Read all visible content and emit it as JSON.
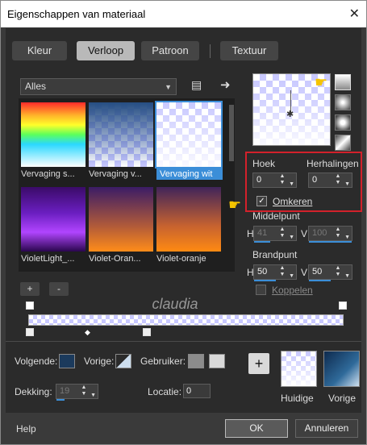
{
  "window": {
    "title": "Eigenschappen van materiaal",
    "close": "✕"
  },
  "tabs": [
    "Kleur",
    "Verloop",
    "Patroon",
    "Textuur"
  ],
  "library": {
    "filter_value": "Alles",
    "thumbnails": [
      {
        "label": "Vervaging s..."
      },
      {
        "label": "Vervaging v..."
      },
      {
        "label": "Vervaging wit"
      },
      {
        "label": "VioletLight_..."
      },
      {
        "label": "Violet-Oran..."
      },
      {
        "label": "Violet-oranje"
      }
    ]
  },
  "settings": {
    "hoek_label": "Hoek",
    "hoek_value": "0",
    "herhalingen_label": "Herhalingen",
    "herhalingen_value": "0",
    "omkeren_label": "Omkeren",
    "omkeren_checked": "✓",
    "middelpunt_label": "Middelpunt",
    "h1_label": "H",
    "h1_value": "41",
    "v1_label": "V",
    "v1_value": "100",
    "brandpunt_label": "Brandpunt",
    "h2_label": "H",
    "h2_value": "50",
    "v2_label": "V",
    "v2_value": "50",
    "koppelen_label": "Koppelen"
  },
  "editor": {
    "add": "+",
    "remove": "-",
    "watermark": "claudia"
  },
  "colors": {
    "volgende_label": "Volgende:",
    "vorige_label": "Vorige:",
    "gebruiker_label": "Gebruiker:",
    "volgende_color": "#1b3a5c",
    "gebruiker_color1": "#8c8c8c",
    "gebruiker_color2": "#d9d9d9"
  },
  "dekking": {
    "label": "Dekking:",
    "value": "19"
  },
  "locatie": {
    "label": "Locatie:",
    "value": "0"
  },
  "swatches": {
    "add": "+",
    "huidige_label": "Huidige",
    "vorige_label": "Vorige"
  },
  "footer": {
    "help": "Help",
    "ok": "OK",
    "cancel": "Annuleren"
  }
}
